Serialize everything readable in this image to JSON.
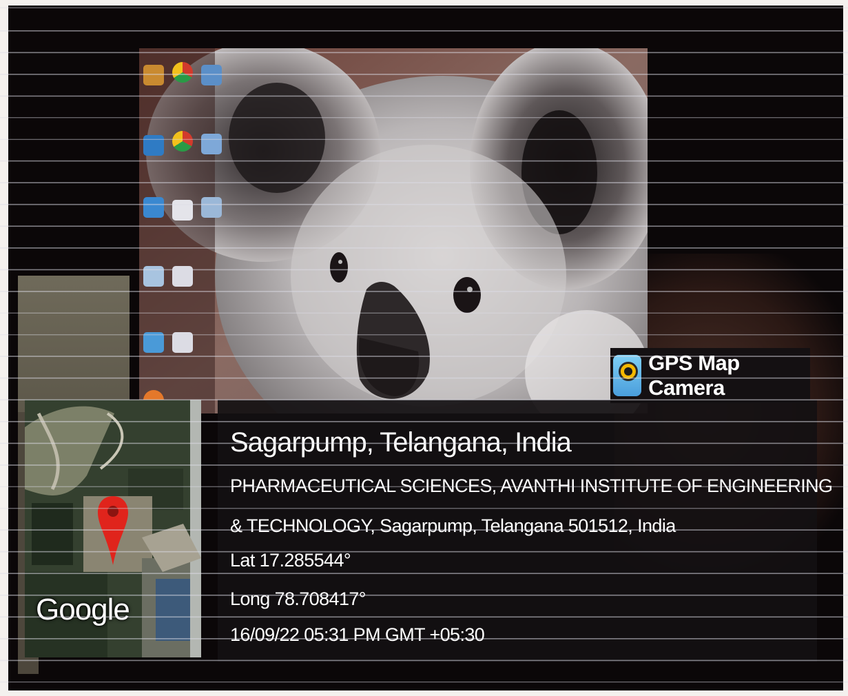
{
  "watermark": {
    "app_name": "GPS Map Camera",
    "icon": "gps-map-camera-app-icon"
  },
  "map": {
    "provider_label": "Google",
    "pin_icon": "location-pin-icon"
  },
  "location": {
    "title": "Sagarpump, Telangana, India",
    "address_line1": "PHARMACEUTICAL SCIENCES, AVANTHI INSTITUTE OF ENGINEERING",
    "address_line2": "& TECHNOLOGY, Sagarpump, Telangana 501512, India",
    "latitude": "Lat 17.285544°",
    "longitude": "Long 78.708417°",
    "timestamp": "16/09/22 05:31 PM GMT +05:30"
  },
  "colors": {
    "background": "#0b0708",
    "panel": "#141012",
    "text": "#ffffff",
    "pin": "#e0241c"
  }
}
